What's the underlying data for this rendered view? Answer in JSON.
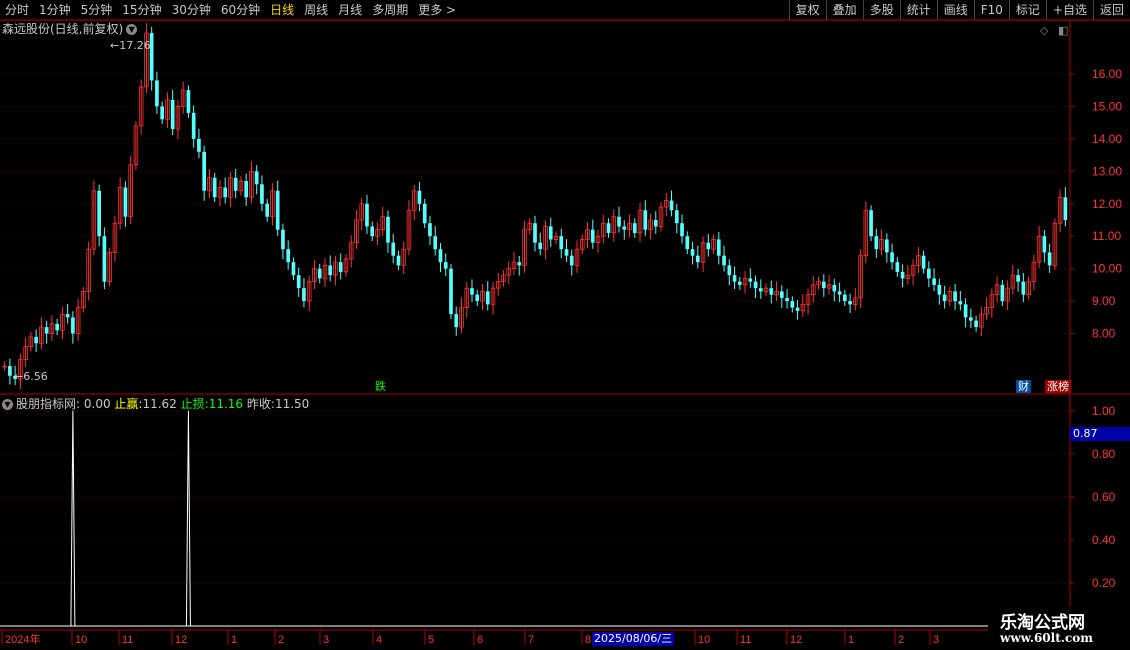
{
  "toolbar": {
    "periods": [
      "分时",
      "1分钟",
      "5分钟",
      "15分钟",
      "30分钟",
      "60分钟",
      "日线",
      "周线",
      "月线",
      "多周期",
      "更多 >"
    ],
    "active_period": "日线",
    "buttons": [
      "复权",
      "叠加",
      "多股",
      "统计",
      "画线",
      "F10",
      "标记",
      "+自选",
      "返回"
    ]
  },
  "chart_title": "森远股份(日线,前复权)",
  "price_axis": [
    "16.00",
    "15.00",
    "14.00",
    "13.00",
    "12.00",
    "11.00",
    "10.00",
    "9.00",
    "8.00"
  ],
  "high_label": "17.26",
  "low_label": "6.56",
  "badges": {
    "drop": "跌",
    "finance": "财",
    "limitup": "涨榜"
  },
  "indicator": {
    "name": "股朋指标网",
    "value": ": 0.00",
    "stop_win_label": "止赢:",
    "stop_win_value": "11.62",
    "stop_loss_label": "止损:",
    "stop_loss_value": "11.16",
    "prev_close_label": "昨收:",
    "prev_close_value": "11.50"
  },
  "indicator_axis": [
    "1.00",
    "0.80",
    "0.60",
    "0.40",
    "0.20"
  ],
  "current_value": "0.87",
  "time_axis": [
    "2024年",
    "10",
    "11",
    "12",
    "1",
    "2",
    "3",
    "4",
    "5",
    "6",
    "7",
    "8",
    "10",
    "11",
    "12",
    "1",
    "2",
    "3"
  ],
  "cursor_date": "2025/08/06/三",
  "watermark": {
    "line1": "乐淘公式网",
    "line2": "www.60lt.com"
  },
  "colors": {
    "up": "#ff3232",
    "down": "#54ffff",
    "grid": "#5a0000",
    "axis": "#b40000",
    "active": "#ffd700"
  },
  "chart_data": {
    "type": "candlestick",
    "title": "森远股份(日线,前复权)",
    "ylim": [
      6.56,
      17.26
    ],
    "y_ticks": [
      8,
      9,
      10,
      11,
      12,
      13,
      14,
      15,
      16
    ],
    "close_series": [
      7.0,
      6.7,
      6.6,
      7.2,
      7.6,
      7.9,
      7.7,
      8.2,
      8.0,
      8.3,
      8.1,
      8.6,
      8.5,
      8.0,
      8.8,
      9.3,
      10.6,
      12.4,
      11.0,
      9.6,
      10.5,
      11.4,
      12.5,
      11.6,
      13.2,
      14.4,
      15.6,
      17.26,
      15.8,
      15.0,
      14.6,
      15.2,
      14.3,
      15.0,
      15.5,
      14.8,
      14.0,
      13.6,
      12.4,
      12.8,
      12.2,
      12.5,
      12.2,
      12.8,
      12.4,
      12.7,
      12.2,
      13.0,
      12.6,
      12.0,
      11.6,
      12.4,
      11.2,
      10.6,
      10.2,
      9.8,
      9.4,
      9.0,
      9.6,
      10.0,
      9.7,
      10.1,
      9.8,
      10.2,
      9.9,
      10.3,
      10.8,
      11.5,
      12.0,
      11.3,
      11.0,
      11.2,
      11.6,
      10.8,
      10.4,
      10.1,
      10.6,
      11.8,
      12.4,
      12.0,
      11.4,
      11.0,
      10.6,
      10.2,
      10.0,
      8.6,
      8.2,
      8.8,
      9.4,
      9.2,
      9.0,
      9.3,
      8.9,
      9.4,
      9.6,
      9.8,
      10.0,
      10.2,
      10.1,
      11.2,
      11.4,
      10.8,
      10.6,
      11.3,
      10.9,
      11.0,
      10.6,
      10.4,
      10.1,
      10.6,
      10.9,
      11.2,
      10.8,
      11.0,
      11.4,
      11.1,
      11.6,
      11.3,
      11.2,
      11.4,
      11.1,
      11.8,
      11.2,
      11.5,
      11.3,
      11.9,
      12.1,
      11.8,
      11.4,
      11.0,
      10.6,
      10.4,
      10.2,
      10.8,
      10.6,
      10.9,
      10.4,
      10.1,
      9.8,
      9.6,
      9.5,
      9.7,
      9.6,
      9.4,
      9.3,
      9.4,
      9.2,
      9.3,
      9.1,
      9.0,
      8.8,
      8.7,
      8.9,
      9.2,
      9.5,
      9.6,
      9.4,
      9.5,
      9.3,
      9.2,
      9.0,
      8.9,
      9.1,
      10.4,
      11.8,
      11.0,
      10.6,
      10.9,
      10.5,
      10.2,
      9.9,
      9.7,
      9.8,
      10.1,
      10.4,
      10.0,
      9.7,
      9.5,
      9.2,
      9.0,
      9.3,
      9.0,
      8.9,
      8.5,
      8.4,
      8.2,
      8.6,
      8.8,
      9.2,
      9.5,
      9.0,
      9.4,
      9.8,
      9.6,
      9.2,
      9.6,
      10.2,
      11.0,
      10.5,
      10.1,
      11.4,
      12.2,
      11.5
    ],
    "indicator_signals": [
      {
        "date_index": 13,
        "value": 1.0
      },
      {
        "date_index": 35,
        "value": 1.0
      }
    ],
    "indicator_ylim": [
      0,
      1.05
    ]
  }
}
